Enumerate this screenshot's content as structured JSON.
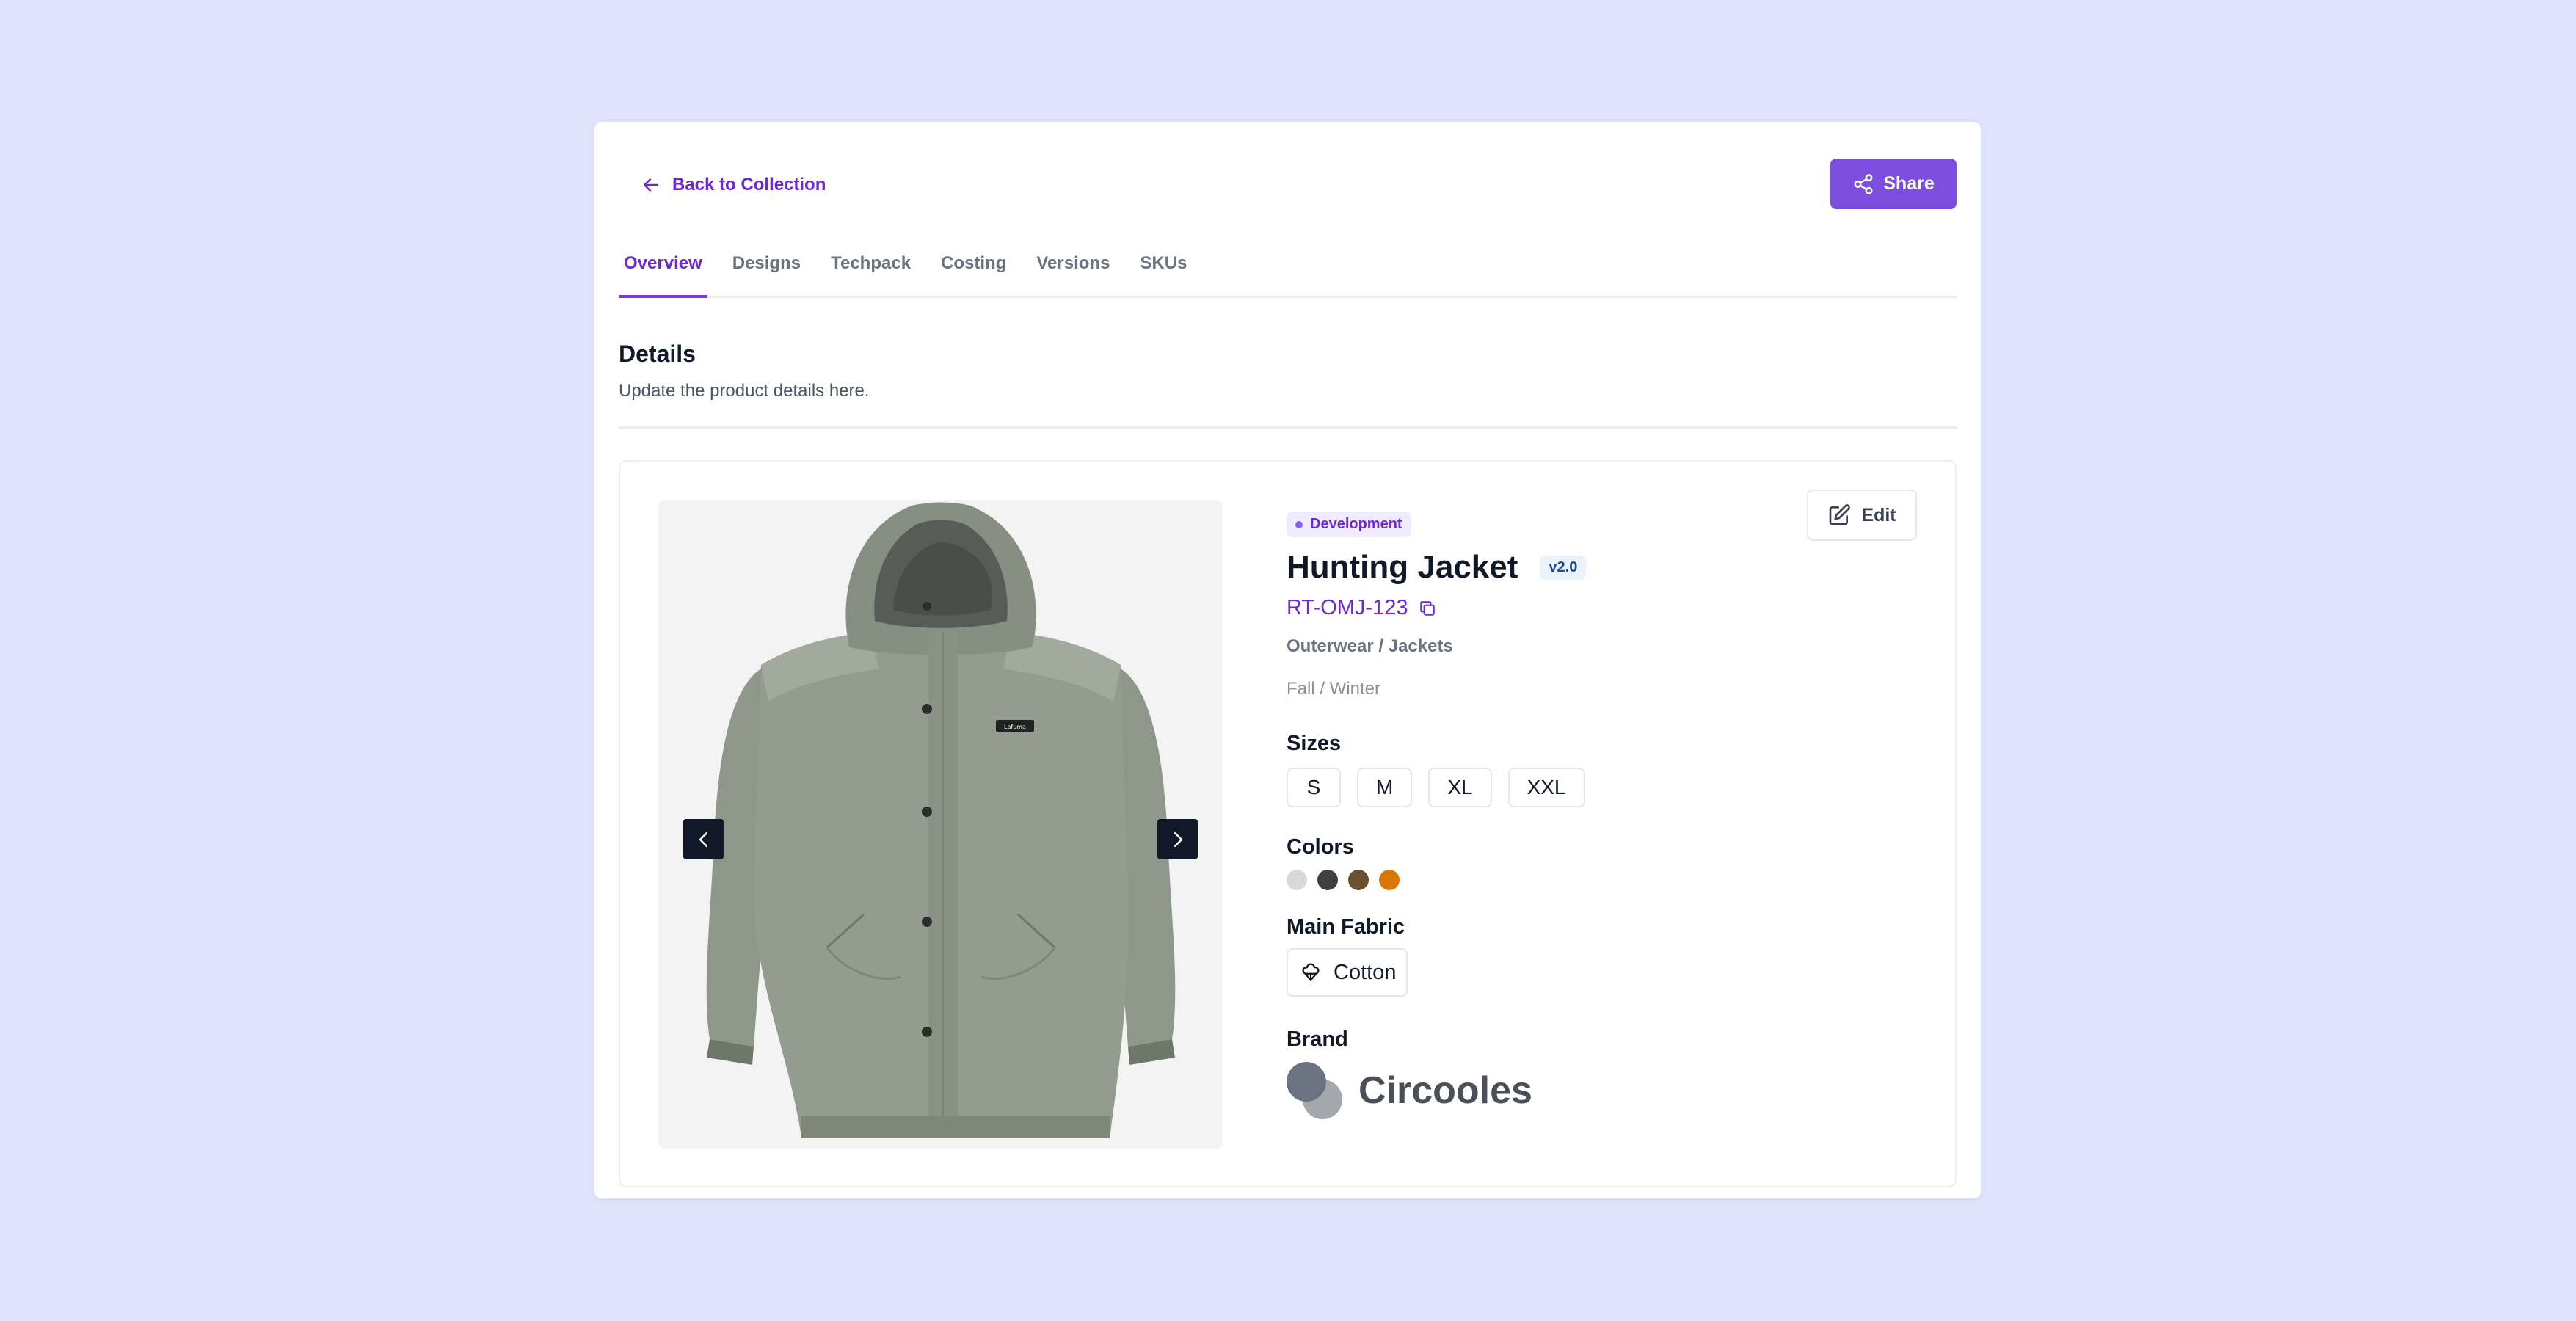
{
  "header": {
    "back_label": "Back to Collection",
    "share_label": "Share"
  },
  "tabs": [
    {
      "label": "Overview",
      "active": true
    },
    {
      "label": "Designs"
    },
    {
      "label": "Techpack"
    },
    {
      "label": "Costing"
    },
    {
      "label": "Versions"
    },
    {
      "label": "SKUs"
    }
  ],
  "details": {
    "title": "Details",
    "subtitle": "Update the product details here."
  },
  "product": {
    "status": "Development",
    "name": "Hunting Jacket",
    "version": "v2.0",
    "sku": "RT-OMJ-123",
    "category": "Outerwear / Jackets",
    "season": "Fall / Winter",
    "edit_label": "Edit",
    "image_label": "Lafuma",
    "sizes_label": "Sizes",
    "sizes": [
      "S",
      "M",
      "XL",
      "XXL"
    ],
    "colors_label": "Colors",
    "colors": [
      "#d9d9d9",
      "#404040",
      "#6b4f2e",
      "#d97706"
    ],
    "fabric_label": "Main Fabric",
    "fabric": "Cotton",
    "brand_label": "Brand",
    "brand": "Circooles"
  },
  "theme": {
    "accent": "#7c4dde",
    "background": "#e0e4fd"
  }
}
